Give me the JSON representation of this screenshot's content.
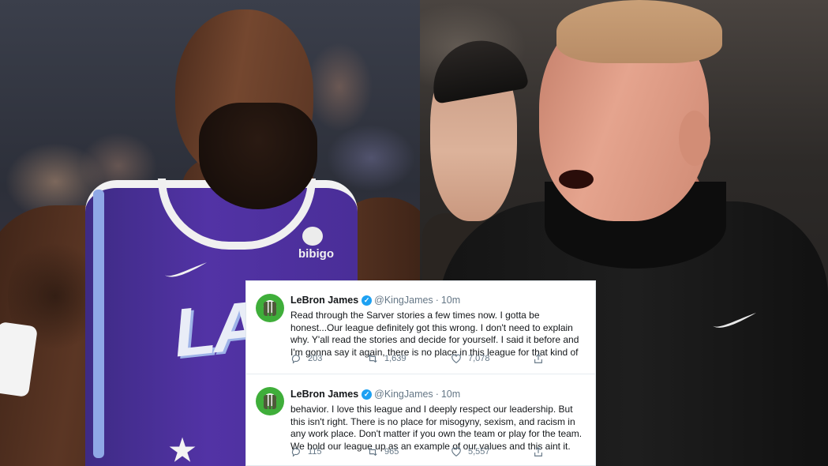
{
  "photo": {
    "jersey_wordmark": "LAK",
    "sponsor": "bibigo"
  },
  "tweets": [
    {
      "name": "LeBron James",
      "handle": "@KingJames",
      "separator": "·",
      "time": "10m",
      "text": "Read through the Sarver stories a few times now. I gotta be honest...Our league definitely got this wrong. I don't need to explain why. Y'all read the stories and decide for yourself. I said it before and I'm gonna say it again, there is no place in this league for that kind of",
      "replies": "203",
      "retweets": "1,639",
      "likes": "7,078"
    },
    {
      "name": "LeBron James",
      "handle": "@KingJames",
      "separator": "·",
      "time": "10m",
      "text": "behavior. I love this league and I deeply respect our leadership. But this isn't right. There is no place for misogyny, sexism, and racism in any work place. Don't matter if you own the team or play for the team. We hold our league up as an example of our values and this aint it.",
      "replies": "115",
      "retweets": "965",
      "likes": "5,557"
    }
  ],
  "colors": {
    "link_blue": "#1da1f2",
    "meta_gray": "#657786",
    "lakers_purple": "#4a2e98"
  },
  "icons": [
    "verified-icon",
    "reply-icon",
    "retweet-icon",
    "like-icon",
    "share-icon",
    "nike-swoosh-icon",
    "star-icon"
  ]
}
